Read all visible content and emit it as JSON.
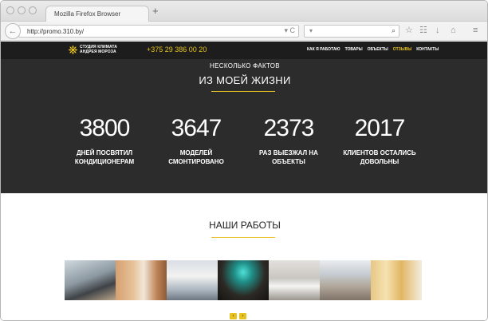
{
  "browser": {
    "tab_title": "Mozilla Firefox Browser",
    "new_tab": "+",
    "url": "http://promo.310.by/",
    "url_icons": "▾ C",
    "search_placeholder": "▾",
    "back_icon": "arrow-left-icon",
    "icons": [
      "search-icon",
      "star-icon",
      "clipboard-icon",
      "download-icon",
      "home-icon",
      "menu-icon"
    ]
  },
  "site": {
    "logo_line1": "СТУДИЯ КЛИМАТА",
    "logo_line2": "АНДРЕЯ МОРОЗА",
    "phone": "+375 29 386 00 20",
    "menu": [
      {
        "label": "КАК Я РАБОТАЮ",
        "active": false
      },
      {
        "label": "ТОВАРЫ",
        "active": false
      },
      {
        "label": "ОБЪЕКТЫ",
        "active": false
      },
      {
        "label": "ОТЗЫВЫ",
        "active": true
      },
      {
        "label": "КОНТАКТЫ",
        "active": false
      }
    ]
  },
  "facts": {
    "subtitle": "НЕСКОЛЬКО ФАКТОВ",
    "title": "ИЗ МОЕЙ ЖИЗНИ",
    "stats": [
      {
        "number": "3800",
        "label_line1": "ДНЕЙ ПОСВЯТИЛ",
        "label_line2": "КОНДИЦИОНЕРАМ"
      },
      {
        "number": "3647",
        "label_line1": "МОДЕЛЕЙ",
        "label_line2": "СМОНТИРОВАНО"
      },
      {
        "number": "2373",
        "label_line1": "РАЗ ВЫЕЗЖАЛ НА",
        "label_line2": "ОБЪЕКТЫ"
      },
      {
        "number": "2017",
        "label_line1": "КЛИЕНТОВ ОСТАЛИСЬ",
        "label_line2": "ДОВОЛЬНЫ"
      }
    ]
  },
  "works": {
    "title": "НАШИ РАБОТЫ",
    "pager": [
      "‹",
      "›"
    ]
  },
  "colors": {
    "accent": "#e8c21e",
    "header_bg": "#1d1d1d",
    "facts_bg": "#2c2c2c"
  }
}
